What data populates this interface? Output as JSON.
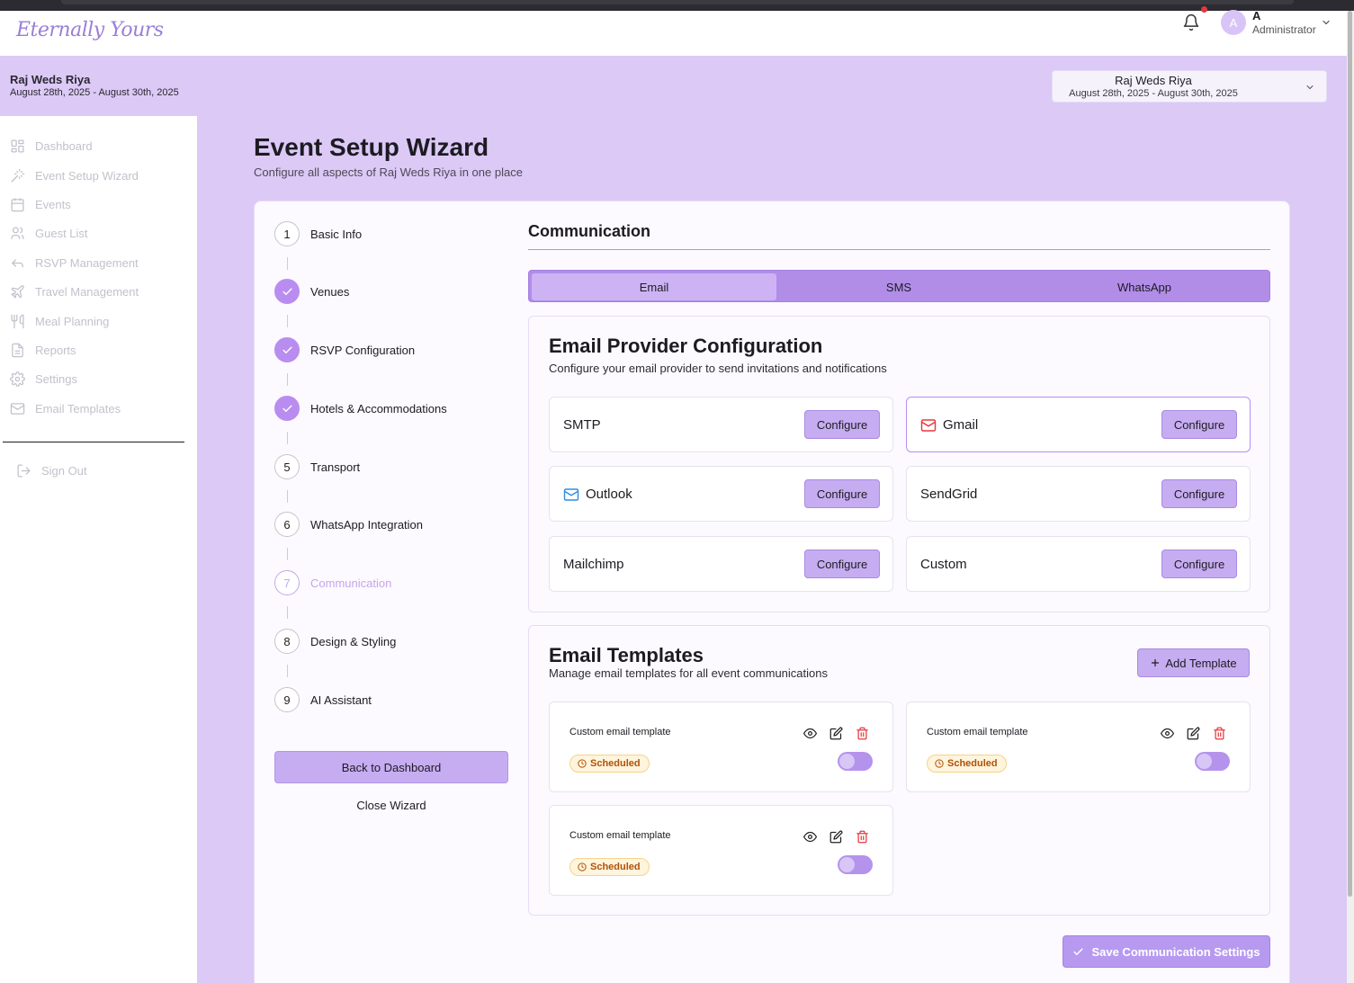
{
  "app": {
    "logo_text": "Eternally Yours"
  },
  "header": {
    "user_initial": "A",
    "user_name": "A",
    "user_role": "Administrator",
    "notification_dot_color": "#e5383b"
  },
  "event": {
    "name": "Raj Weds Riya",
    "dates": "August 28th, 2025 - August 30th, 2025"
  },
  "event_selector": {
    "name": "Raj Weds Riya",
    "dates": "August 28th, 2025 - August 30th, 2025"
  },
  "sidebar": {
    "items": [
      {
        "label": "Dashboard",
        "icon": "grid-icon"
      },
      {
        "label": "Event Setup Wizard",
        "icon": "wand-icon"
      },
      {
        "label": "Events",
        "icon": "calendar-icon"
      },
      {
        "label": "Guest List",
        "icon": "users-icon"
      },
      {
        "label": "RSVP Management",
        "icon": "reply-icon"
      },
      {
        "label": "Travel Management",
        "icon": "plane-icon"
      },
      {
        "label": "Meal Planning",
        "icon": "utensils-icon"
      },
      {
        "label": "Reports",
        "icon": "file-icon"
      },
      {
        "label": "Settings",
        "icon": "gear-icon"
      },
      {
        "label": "Email Templates",
        "icon": "mail-icon"
      }
    ],
    "sign_out": "Sign Out"
  },
  "page": {
    "title": "Event Setup Wizard",
    "subtitle": "Configure all aspects of Raj Weds Riya in one place"
  },
  "wizard": {
    "steps": [
      {
        "number": "1",
        "label": "Basic Info",
        "state": "pending"
      },
      {
        "number": "2",
        "label": "Venues",
        "state": "done"
      },
      {
        "number": "3",
        "label": "RSVP Configuration",
        "state": "done"
      },
      {
        "number": "4",
        "label": "Hotels & Accommodations",
        "state": "done"
      },
      {
        "number": "5",
        "label": "Transport",
        "state": "pending"
      },
      {
        "number": "6",
        "label": "WhatsApp Integration",
        "state": "pending"
      },
      {
        "number": "7",
        "label": "Communication",
        "state": "active"
      },
      {
        "number": "8",
        "label": "Design & Styling",
        "state": "pending"
      },
      {
        "number": "9",
        "label": "AI Assistant",
        "state": "pending"
      }
    ],
    "back_button": "Back to Dashboard",
    "close_button": "Close Wizard"
  },
  "communication": {
    "title": "Communication",
    "tabs": [
      {
        "label": "Email",
        "active": true
      },
      {
        "label": "SMS",
        "active": false
      },
      {
        "label": "WhatsApp",
        "active": false
      }
    ],
    "provider_section": {
      "title": "Email Provider Configuration",
      "subtitle": "Configure your email provider to send invitations and notifications",
      "configure_label": "Configure",
      "providers": [
        {
          "name": "SMTP",
          "icon": "",
          "selected": false
        },
        {
          "name": "Gmail",
          "icon": "mail-icon",
          "selected": true
        },
        {
          "name": "Outlook",
          "icon": "mail-icon",
          "selected": false
        },
        {
          "name": "SendGrid",
          "icon": "",
          "selected": false
        },
        {
          "name": "Mailchimp",
          "icon": "",
          "selected": false
        },
        {
          "name": "Custom",
          "icon": "",
          "selected": false
        }
      ]
    },
    "templates_section": {
      "title": "Email Templates",
      "subtitle": "Manage email templates for all event communications",
      "add_button": "Add Template",
      "templates": [
        {
          "name": "Custom email template",
          "status": "Scheduled",
          "enabled": false
        },
        {
          "name": "Custom email template",
          "status": "Scheduled",
          "enabled": false
        },
        {
          "name": "Custom email template",
          "status": "Scheduled",
          "enabled": false
        }
      ]
    },
    "save_button": "Save Communication Settings"
  },
  "colors": {
    "accent": "#b98df0",
    "background": "#dcc9f6",
    "gmail_icon": "#e5383b",
    "outlook_icon": "#2f8de4",
    "delete_icon": "#e5383b",
    "badge_text": "#b0520a"
  }
}
